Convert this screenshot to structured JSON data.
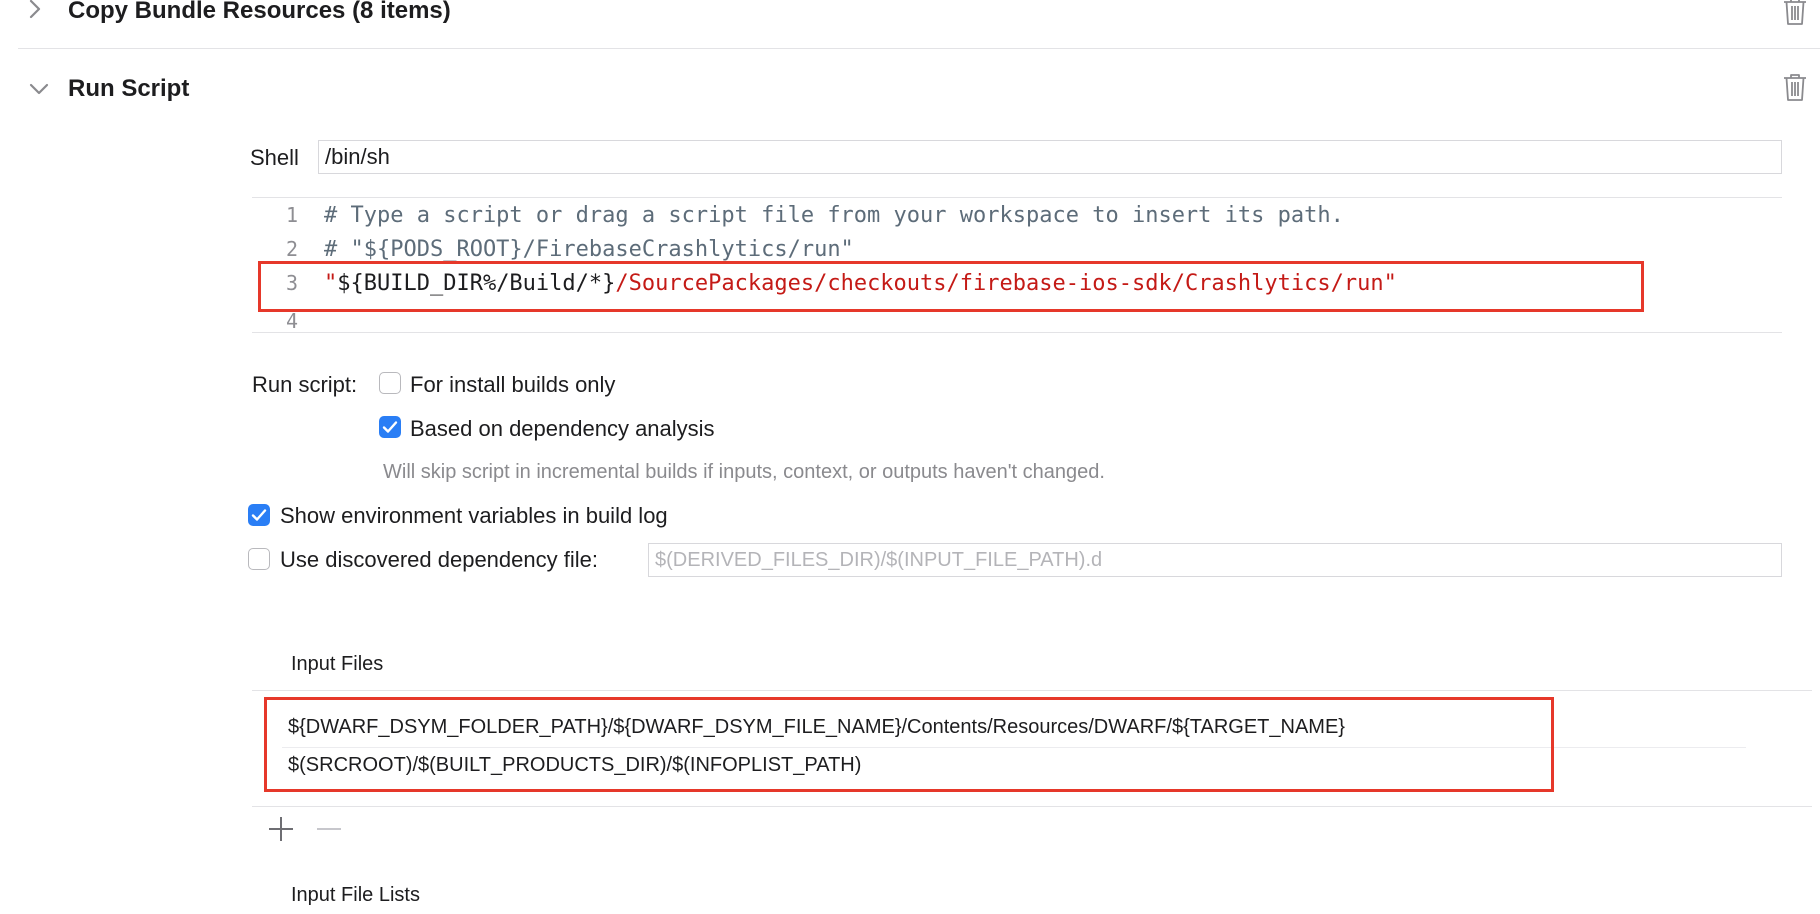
{
  "phases": {
    "copy_bundle": {
      "title": "Copy Bundle Resources (8 items)",
      "expanded": false,
      "chevron_icon": "chevron-right-icon",
      "delete_icon": "trash-icon"
    },
    "run_script": {
      "title": "Run Script",
      "expanded": true,
      "chevron_icon": "chevron-down-icon",
      "delete_icon": "trash-icon"
    }
  },
  "shell": {
    "label": "Shell",
    "value": "/bin/sh"
  },
  "script": {
    "lines": [
      {
        "number": "1",
        "text": "# Type a script or drag a script file from your workspace to insert its path."
      },
      {
        "number": "2",
        "text": "# \"${PODS_ROOT}/FirebaseCrashlytics/run\""
      },
      {
        "number": "3",
        "text_plain": "\"${BUILD_DIR%/Build/*}",
        "text_string": "/SourcePackages/checkouts/firebase-ios-sdk/Crashlytics/run\"",
        "open_quote": "\"",
        "middle": "${BUILD_DIR%/Build/*}"
      },
      {
        "number": "4",
        "text": ""
      }
    ]
  },
  "options": {
    "run_script_label": "Run script:",
    "install_builds_only": {
      "label": "For install builds only",
      "checked": false
    },
    "dependency_analysis": {
      "label": "Based on dependency analysis",
      "checked": true
    },
    "dependency_hint": "Will skip script in incremental builds if inputs, context, or outputs haven't changed.",
    "show_env_vars": {
      "label": "Show environment variables in build log",
      "checked": true
    },
    "discovered_dep_file": {
      "label": "Use discovered dependency file:",
      "checked": false,
      "placeholder": "$(DERIVED_FILES_DIR)/$(INPUT_FILE_PATH).d"
    }
  },
  "input_files": {
    "header": "Input Files",
    "items": [
      "${DWARF_DSYM_FOLDER_PATH}/${DWARF_DSYM_FILE_NAME}/Contents/Resources/DWARF/${TARGET_NAME}",
      "$(SRCROOT)/$(BUILT_PRODUCTS_DIR)/$(INFOPLIST_PATH)"
    ],
    "add_icon": "plus-icon",
    "remove_icon": "minus-icon"
  },
  "input_file_lists": {
    "header": "Input File Lists"
  },
  "colors": {
    "highlight_border": "#e6382a",
    "checkbox_accent": "#2a7ef5",
    "string_red": "#c41a16",
    "comment_gray": "#5d6c79"
  }
}
